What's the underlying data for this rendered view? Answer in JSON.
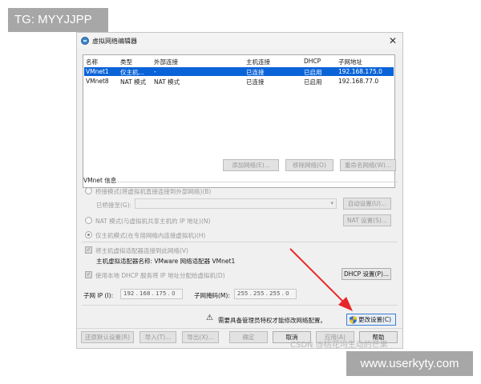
{
  "watermarks": {
    "top": "TG: MYYJJPP",
    "bottom": "www.userkyty.com",
    "csdn": "CSDN @桃花坞生动的芒果"
  },
  "window": {
    "title": "虚拟网络编辑器",
    "close_glyph": "✕"
  },
  "network_table": {
    "headers": [
      "名称",
      "类型",
      "外部连接",
      "主机连接",
      "DHCP",
      "子网地址"
    ],
    "rows": [
      [
        "VMnet1",
        "仅主机...",
        "-",
        "已连接",
        "已启用",
        "192.168.175.0"
      ],
      [
        "VMnet8",
        "NAT 模式",
        "NAT 模式",
        "已连接",
        "已启用",
        "192.168.77.0"
      ]
    ],
    "selected_index": 0
  },
  "table_buttons": {
    "add": "添加网络(E)...",
    "remove": "移除网络(O)",
    "rename": "重命名网络(W)..."
  },
  "vmnet_info": {
    "section_label": "VMnet 信息",
    "bridged_label": "桥接模式(将虚拟机直接连接到外部网络)(B)",
    "bridged_to_label": "已桥接至(G):",
    "auto_settings": "自动设置(U)...",
    "nat_label": "NAT 模式(与虚拟机共享主机的 IP 地址)(N)",
    "nat_settings": "NAT 设置(S)...",
    "hostonly_label": "仅主机模式(在专用网络内连接虚拟机)(H)",
    "connect_adapter_label": "将主机虚拟适配器连接到此网络(V)",
    "adapter_name_label": "主机虚拟适配器名称: VMware 网络适配器 VMnet1",
    "dhcp_label": "使用本地 DHCP 服务将 IP 地址分配给虚拟机(D)",
    "dhcp_settings": "DHCP 设置(P)...",
    "subnet_ip_label": "子网 IP (I):",
    "subnet_ip_value": "192 . 168 . 175 . 0",
    "subnet_mask_label": "子网掩码(M):",
    "subnet_mask_value": "255 . 255 . 255 . 0"
  },
  "admin_notice": {
    "text": "需要具备管理员特权才能修改网络配置。",
    "change_settings": "更改设置(C)"
  },
  "footer_buttons": {
    "restore": "还原默认设置(R)",
    "import": "导入(T)...",
    "export": "导出(X)...",
    "ok": "确定",
    "cancel": "取消",
    "apply": "应用(A)",
    "help": "帮助"
  },
  "colors": {
    "selection": "#0a64d8",
    "arrow": "#e8262a",
    "shield_blue": "#2f6fd1",
    "shield_yellow": "#f2c21b"
  },
  "icons": [
    "network-editor-icon",
    "close-icon",
    "warning-icon",
    "admin-shield-icon",
    "dropdown-arrow-icon",
    "annotation-arrow"
  ]
}
